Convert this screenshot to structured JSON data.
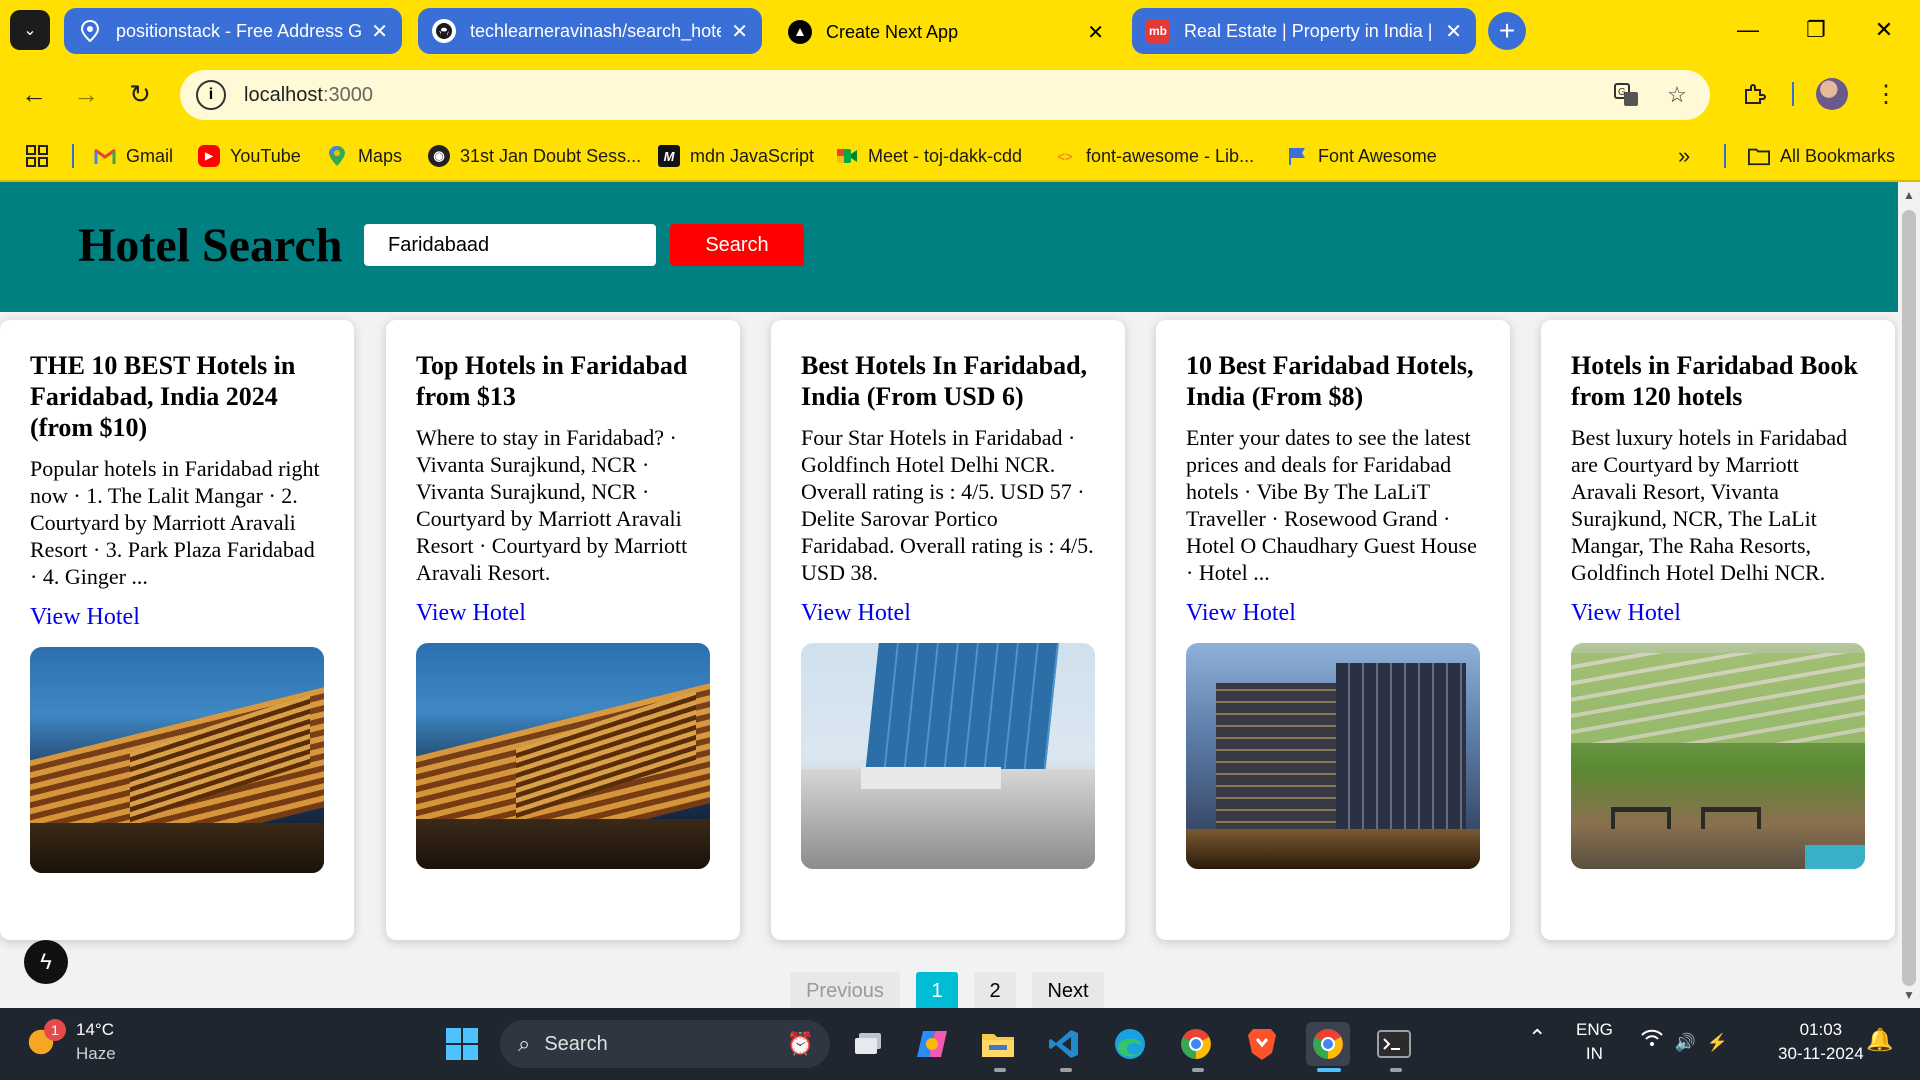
{
  "browser": {
    "tabs": [
      {
        "title": "positionstack - Free Address Ge",
        "icon": "map-pin-icon",
        "active": false
      },
      {
        "title": "techlearneravinash/search_hote",
        "icon": "github-icon",
        "active": false
      },
      {
        "title": "Create Next App",
        "icon": "nextjs-icon",
        "active": true
      },
      {
        "title": "Real Estate | Property in India |",
        "icon": "magicbricks-icon",
        "favicon_text": "mb",
        "active": false
      }
    ],
    "address": {
      "host": "localhost",
      "port": ":3000"
    },
    "bookmarks": [
      {
        "label": "Gmail",
        "icon": "gmail-icon"
      },
      {
        "label": "YouTube",
        "icon": "youtube-icon"
      },
      {
        "label": "Maps",
        "icon": "maps-icon"
      },
      {
        "label": "31st Jan Doubt Sess...",
        "icon": "doubt-session-icon"
      },
      {
        "label": "mdn JavaScript",
        "icon": "mdn-icon",
        "favicon_text": "M"
      },
      {
        "label": "Meet - toj-dakk-cdd",
        "icon": "meet-icon"
      },
      {
        "label": "font-awesome - Lib...",
        "icon": "code-icon"
      },
      {
        "label": "Font Awesome",
        "icon": "flag-icon"
      }
    ],
    "all_bookmarks": "All Bookmarks"
  },
  "app": {
    "title": "Hotel Search",
    "search_value": "Faridabaad",
    "search_button": "Search",
    "link_label": "View Hotel",
    "results": [
      {
        "title": "THE 10 BEST Hotels in Faridabad, India 2024 (from $10)",
        "snippet": "Popular hotels in Faridabad right now · 1. The Lalit Mangar · 2. Courtyard by Marriott Aravali Resort · 3. Park Plaza Faridabad · 4. Ginger ...",
        "image": "resort-night"
      },
      {
        "title": "Top Hotels in Faridabad from $13",
        "snippet": "Where to stay in Faridabad? · Vivanta Surajkund, NCR · Vivanta Surajkund, NCR · Courtyard by Marriott Aravali Resort · Courtyard by Marriott Aravali Resort.",
        "image": "resort-night"
      },
      {
        "title": "Best Hotels In Faridabad, India (From USD 6)",
        "snippet": "Four Star Hotels in Faridabad · Goldfinch Hotel Delhi NCR. Overall rating is : 4/5. USD 57 · Delite Sarovar Portico Faridabad. Overall rating is : 4/5. USD 38.",
        "image": "glass-tower"
      },
      {
        "title": "10 Best Faridabad Hotels, India (From $8)",
        "snippet": "Enter your dates to see the latest prices and deals for Faridabad hotels · Vibe By The LaLiT Traveller · Rosewood Grand · Hotel O Chaudhary Guest House · Hotel ...",
        "image": "night-towers"
      },
      {
        "title": "Hotels in Faridabad Book from 120 hotels",
        "snippet": "Best luxury hotels in Faridabad are Courtyard by Marriott Aravali Resort, Vivanta Surajkund, NCR, The LaLit Mangar, The Raha Resorts, Goldfinch Hotel Delhi NCR.",
        "image": "garden-terrace"
      }
    ],
    "pagination": {
      "previous": "Previous",
      "pages": [
        "1",
        "2"
      ],
      "current": "1",
      "next": "Next"
    },
    "colors": {
      "header": "#008080",
      "search_button": "#ff0000",
      "active_page": "#00bcd4",
      "link": "#0000ee"
    }
  },
  "taskbar": {
    "weather": {
      "temp": "14°C",
      "condition": "Haze",
      "badge": "1"
    },
    "search_placeholder": "Search",
    "language": {
      "line1": "ENG",
      "line2": "IN"
    },
    "clock": {
      "time": "01:03",
      "date": "30-11-2024"
    }
  }
}
